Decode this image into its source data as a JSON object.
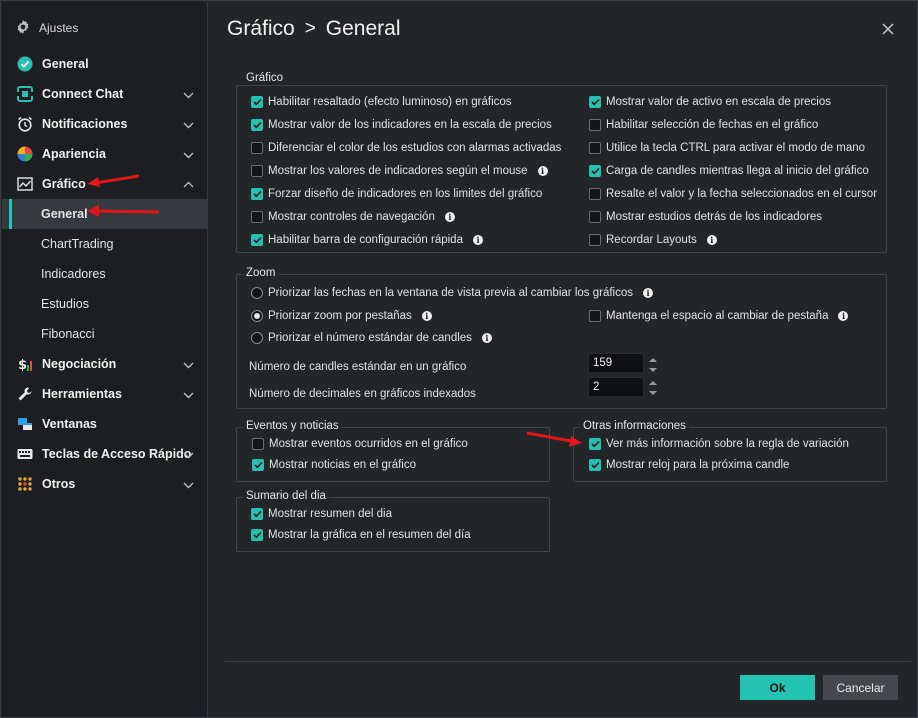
{
  "window": {
    "title": "Ajustes"
  },
  "sidebar": {
    "items": [
      {
        "label": "General",
        "icon": "check-circle-icon"
      },
      {
        "label": "Connect Chat",
        "icon": "connect-icon"
      },
      {
        "label": "Notificaciones",
        "icon": "alarm-clock-icon"
      },
      {
        "label": "Apariencia",
        "icon": "palette-icon"
      },
      {
        "label": "Gráfico",
        "icon": "chart-icon"
      },
      {
        "label": "Negociación",
        "icon": "dollar-icon"
      },
      {
        "label": "Herramientas",
        "icon": "wrench-icon"
      },
      {
        "label": "Ventanas",
        "icon": "windows-icon"
      },
      {
        "label": "Teclas de Acceso Rápido",
        "icon": "keyboard-icon"
      },
      {
        "label": "Otros",
        "icon": "grid-dots-icon"
      }
    ],
    "subitems": [
      "General",
      "ChartTrading",
      "Indicadores",
      "Estudios",
      "Fibonacci"
    ]
  },
  "header": {
    "section": "Gráfico",
    "separator": ">",
    "page": "General"
  },
  "grafico": {
    "title": "Gráfico",
    "left": [
      {
        "label": "Habilitar resaltado (efecto luminoso) en gráficos",
        "checked": true
      },
      {
        "label": "Mostrar valor de los indicadores en la escala de precios",
        "checked": true
      },
      {
        "label": "Diferenciar el color de los estudios con alarmas activadas",
        "checked": false
      },
      {
        "label": "Mostrar los valores de indicadores según el mouse",
        "checked": false
      },
      {
        "label": "Forzar diseño de indicadores en los limites del gráfico",
        "checked": true
      },
      {
        "label": "Mostrar controles de navegación",
        "checked": false
      },
      {
        "label": "Habilitar barra de configuración rápida",
        "checked": true
      }
    ],
    "right": [
      {
        "label": "Mostrar valor de activo en escala de precios",
        "checked": true
      },
      {
        "label": "Habilitar selección de fechas en el gráfico",
        "checked": false
      },
      {
        "label": "Utilice la tecla CTRL para activar el modo de mano",
        "checked": false
      },
      {
        "label": "Carga de candles mientras llega al inicio del gráfico",
        "checked": true
      },
      {
        "label": "Resalte el valor y la fecha seleccionados en el cursor",
        "checked": false
      },
      {
        "label": "Mostrar estudios detrás de los indicadores",
        "checked": false
      },
      {
        "label": "Recordar Layouts",
        "checked": false
      }
    ]
  },
  "zoom": {
    "title": "Zoom",
    "radio1": "Priorizar las fechas en la ventana de vista previa al cambiar los gráficos",
    "radio2": "Priorizar zoom por pestañas",
    "radio3": "Priorizar el número estándar de candles",
    "selected_radio": 2,
    "keep_space": {
      "label": "Mantenga el espacio al cambiar de pestaña",
      "checked": false
    },
    "candles_label": "Número de candles estándar en un gráfico",
    "candles_value": "159",
    "decimals_label": "Número de decimales en gráficos indexados",
    "decimals_value": "2"
  },
  "eventos": {
    "title": "Eventos y noticias",
    "items": [
      {
        "label": "Mostrar eventos ocurridos en el gráfico",
        "checked": false
      },
      {
        "label": "Mostrar noticias en el gráfico",
        "checked": true
      }
    ]
  },
  "otras": {
    "title": "Otras informaciones",
    "items": [
      {
        "label": "Ver más información sobre la regla de variación",
        "checked": true
      },
      {
        "label": "Mostrar reloj para la próxima candle",
        "checked": true
      }
    ]
  },
  "sumario": {
    "title": "Sumario del dia",
    "items": [
      {
        "label": "Mostrar resumen del dia",
        "checked": true
      },
      {
        "label": "Mostrar la gráfica en el resumen del día",
        "checked": true
      }
    ]
  },
  "footer": {
    "ok_label": "Ok",
    "cancel_label": "Cancelar"
  },
  "colors": {
    "accent": "#22c3b3",
    "background": "#232629",
    "sidebar": "#1c1e21",
    "annotation_arrow": "#e0161b"
  }
}
